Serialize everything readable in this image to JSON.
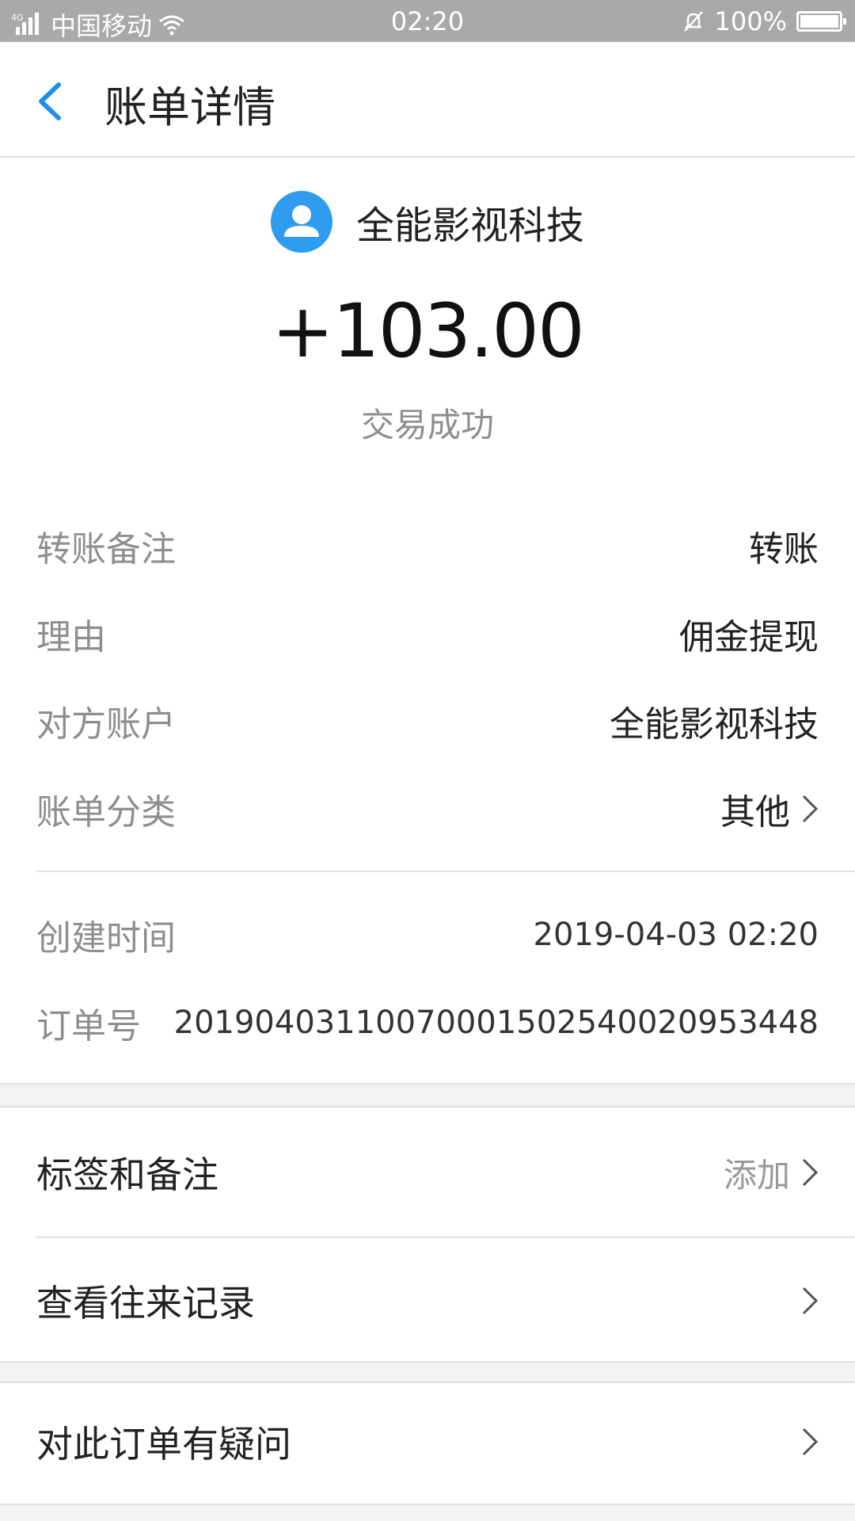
{
  "status_bar": {
    "network_badge": "4G",
    "carrier": "中国移动",
    "time": "02:20",
    "battery": "100%"
  },
  "nav": {
    "title": "账单详情"
  },
  "transaction": {
    "payee_name": "全能影视科技",
    "amount": "+103.00",
    "status": "交易成功"
  },
  "details": [
    {
      "label": "转账备注",
      "value": "转账"
    },
    {
      "label": "理由",
      "value": "佣金提现"
    },
    {
      "label": "对方账户",
      "value": "全能影视科技"
    },
    {
      "label": "账单分类",
      "value": "其他"
    }
  ],
  "meta": [
    {
      "label": "创建时间",
      "value": "2019-04-03 02:20"
    },
    {
      "label": "订单号",
      "value": "20190403110070001502540020953448"
    }
  ],
  "actions": {
    "tags_label": "标签和备注",
    "tags_add": "添加",
    "history_label": "查看往来记录",
    "question_label": "对此订单有疑问"
  },
  "colors": {
    "accent": "#2f9cf0",
    "status_bar": "#a9a9ab"
  }
}
